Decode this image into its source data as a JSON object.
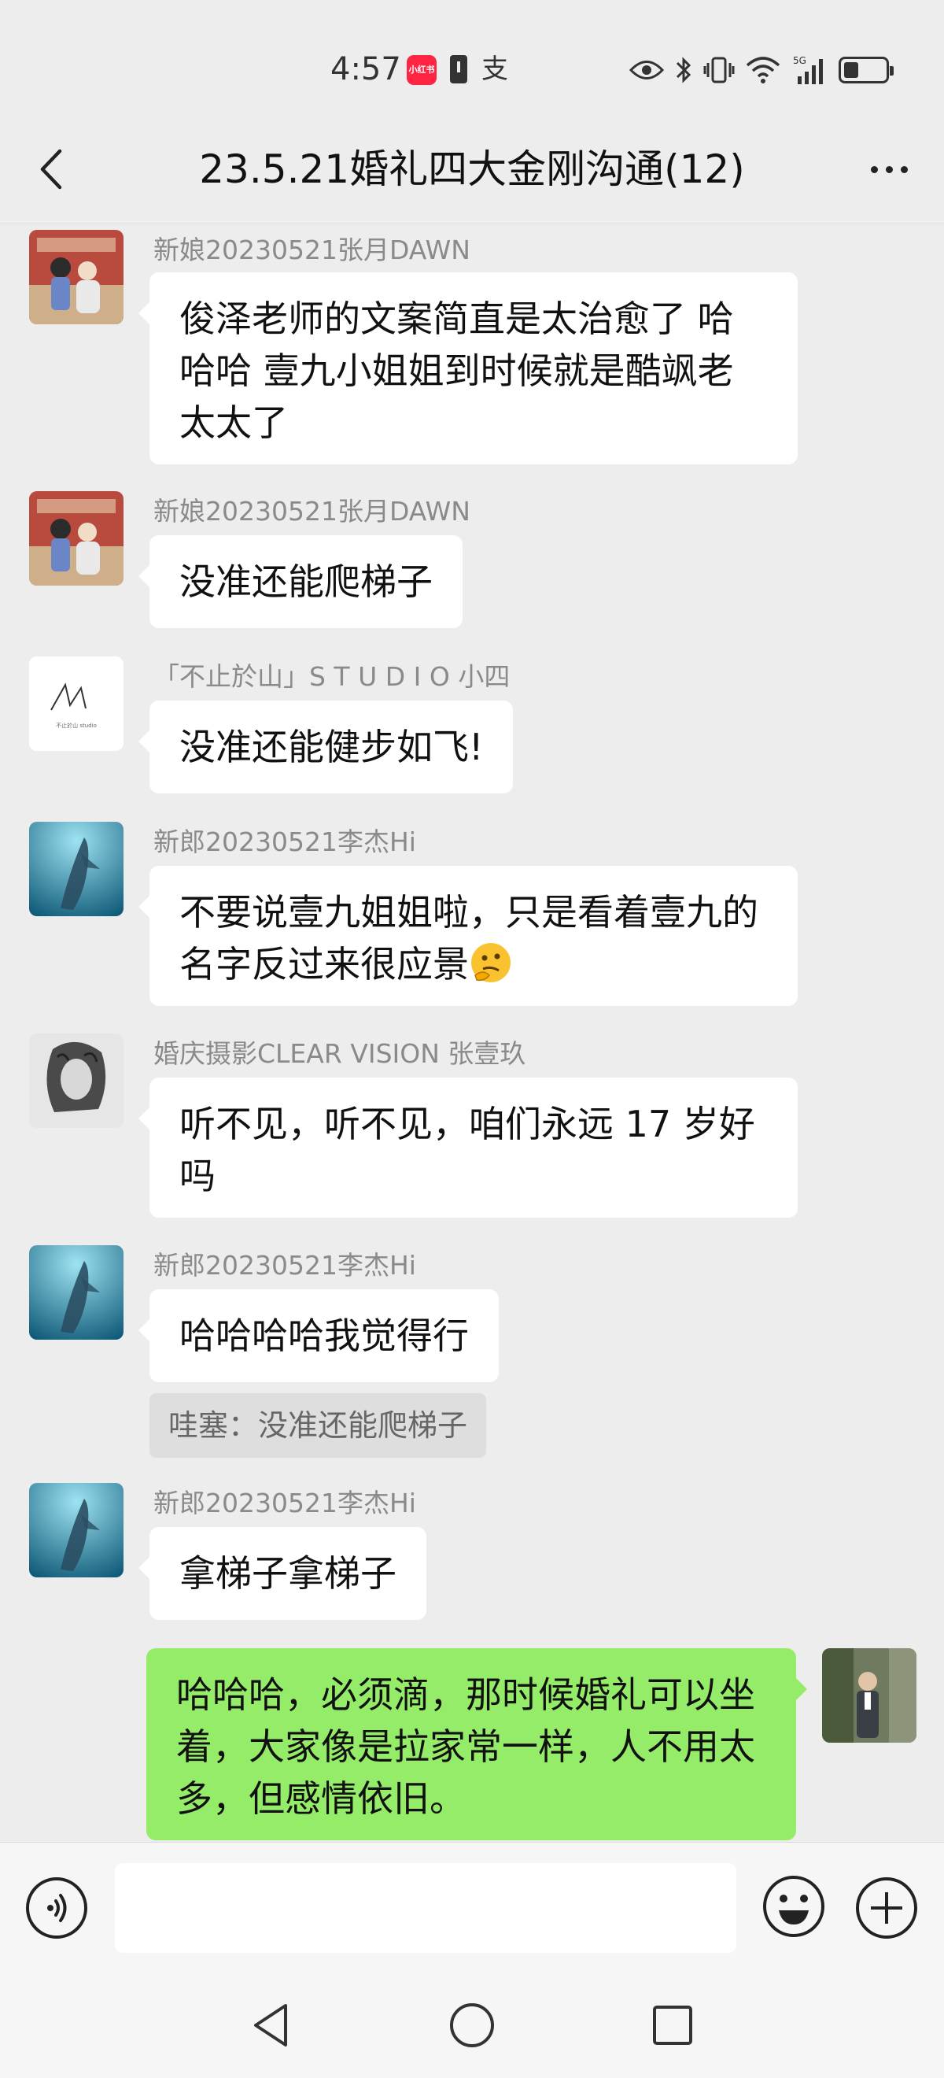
{
  "status_bar": {
    "time": "4:57",
    "app_badge": "小红书",
    "pay_icon": "支",
    "network_label": "5G",
    "icons": [
      "eye-icon",
      "bluetooth-icon",
      "vibrate-icon",
      "wifi-icon",
      "signal-icon",
      "battery-icon"
    ]
  },
  "header": {
    "title": "23.5.21婚礼四大金刚沟通(12)"
  },
  "messages": [
    {
      "sender": "新娘20230521张月DAWN",
      "text": "俊泽老师的文案简直是太治愈了 哈哈哈 壹九小姐姐到时候就是酷飒老太太了"
    },
    {
      "sender": "新娘20230521张月DAWN",
      "text": "没准还能爬梯子"
    },
    {
      "sender": "「不止於山」S T U D I O 小四",
      "text": "没准还能健步如飞!"
    },
    {
      "sender": "新郎20230521李杰Hi",
      "text": "不要说壹九姐姐啦，只是看着壹九的名字反过来很应景"
    },
    {
      "sender": "婚庆摄影CLEAR VISION  张壹玖",
      "text": "听不见，听不见，咱们永远 17 岁好吗"
    },
    {
      "sender": "新郎20230521李杰Hi",
      "text": "哈哈哈哈我觉得行",
      "quote": "哇塞：没准还能爬梯子"
    },
    {
      "sender": "新郎20230521李杰Hi",
      "text": "拿梯子拿梯子"
    },
    {
      "sender": "",
      "text": "哈哈哈，必须滴，那时候婚礼可以坐着，大家像是拉家常一样，人不用太多，但感情依旧。"
    }
  ],
  "studio_logo_text": "不止於山 studio",
  "input": {
    "placeholder": ""
  },
  "colors": {
    "background": "#ededed",
    "my_bubble": "#95ec69",
    "other_bubble": "#ffffff",
    "sender_name": "#8a8a8a"
  }
}
